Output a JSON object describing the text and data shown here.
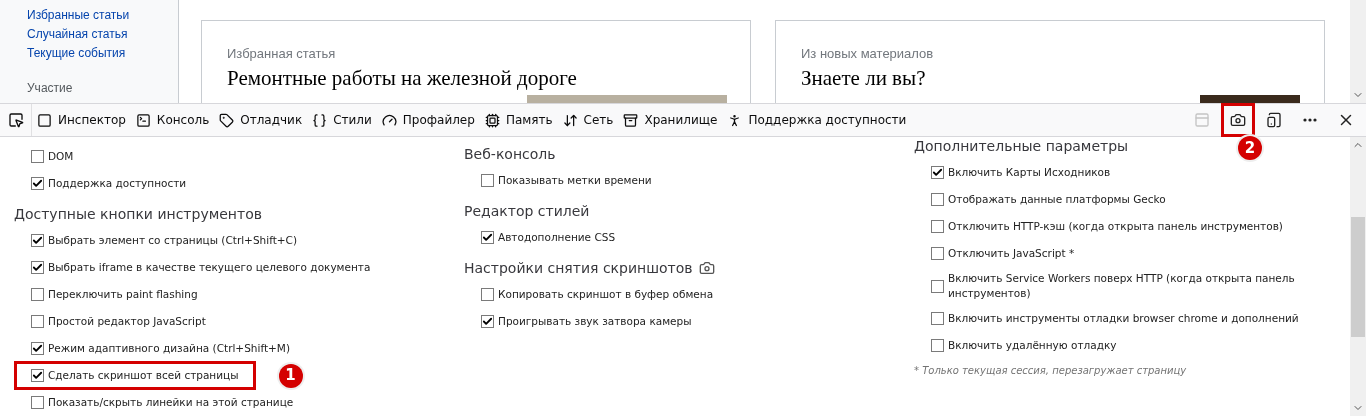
{
  "page": {
    "sidebar_links": [
      "Избранные статьи",
      "Случайная статья",
      "Текущие события"
    ],
    "sidebar_heading": "Участие",
    "cards": [
      {
        "kicker": "Избранная статья",
        "title": "Ремонтные работы на железной дороге"
      },
      {
        "kicker": "Из новых материалов",
        "title": "Знаете ли вы?"
      }
    ]
  },
  "toolbar": {
    "tools": [
      {
        "label": "Инспектор"
      },
      {
        "label": "Консоль"
      },
      {
        "label": "Отладчик"
      },
      {
        "label": "Стили"
      },
      {
        "label": "Профайлер"
      },
      {
        "label": "Память"
      },
      {
        "label": "Сеть"
      },
      {
        "label": "Хранилище"
      },
      {
        "label": "Поддержка доступности"
      }
    ],
    "buttons": [
      {
        "kind": "frames",
        "disabled": true
      },
      {
        "kind": "screenshot",
        "disabled": false,
        "annotation": "2"
      },
      {
        "kind": "responsive",
        "disabled": false
      },
      {
        "kind": "more",
        "disabled": false
      },
      {
        "kind": "close",
        "disabled": false
      }
    ]
  },
  "settings": {
    "columns": [
      {
        "sections": [
          {
            "items": [
              {
                "label": "DOM",
                "checked": false
              },
              {
                "label": "Поддержка доступности",
                "checked": true
              }
            ]
          },
          {
            "heading": "Доступные кнопки инструментов",
            "items": [
              {
                "label": "Выбрать элемент со страницы (Ctrl+Shift+C)",
                "checked": true
              },
              {
                "label": "Выбрать iframe в качестве текущего целевого документа",
                "checked": true
              },
              {
                "label": "Переключить paint flashing",
                "checked": false
              },
              {
                "label": "Простой редактор JavaScript",
                "checked": false
              },
              {
                "label": "Режим адаптивного дизайна (Ctrl+Shift+M)",
                "checked": true
              },
              {
                "label": "Сделать скриншот всей страницы",
                "checked": true,
                "annotation": "1"
              },
              {
                "label": "Показать/скрыть линейки на этой странице",
                "checked": false
              }
            ]
          }
        ]
      },
      {
        "sections": [
          {
            "heading": "Веб-консоль",
            "items": [
              {
                "label": "Показывать метки времени",
                "checked": false
              }
            ]
          },
          {
            "heading": "Редактор стилей",
            "items": [
              {
                "label": "Автодополнение CSS",
                "checked": true
              }
            ]
          },
          {
            "heading": "Настройки снятия скриншотов",
            "camera": true,
            "items": [
              {
                "label": "Копировать скриншот в буфер обмена",
                "checked": false
              },
              {
                "label": "Проигрывать звук затвора камеры",
                "checked": true
              }
            ]
          }
        ]
      },
      {
        "sections": [
          {
            "heading": "Дополнительные параметры",
            "items": [
              {
                "label": "Включить Карты Исходников",
                "checked": true
              },
              {
                "label": "Отображать данные платформы Gecko",
                "checked": false
              },
              {
                "label": "Отключить HTTP-кэш (когда открыта панель инструментов)",
                "checked": false
              },
              {
                "label": "Отключить JavaScript *",
                "checked": false
              },
              {
                "label": "Включить Service Workers поверх HTTP (когда открыта панель инструментов)",
                "checked": false
              },
              {
                "label": "Включить инструменты отладки browser chrome и дополнений",
                "checked": false
              },
              {
                "label": "Включить удалённую отладку",
                "checked": false
              }
            ]
          }
        ],
        "note": "* Только текущая сессия, перезагружает страницу"
      }
    ]
  }
}
